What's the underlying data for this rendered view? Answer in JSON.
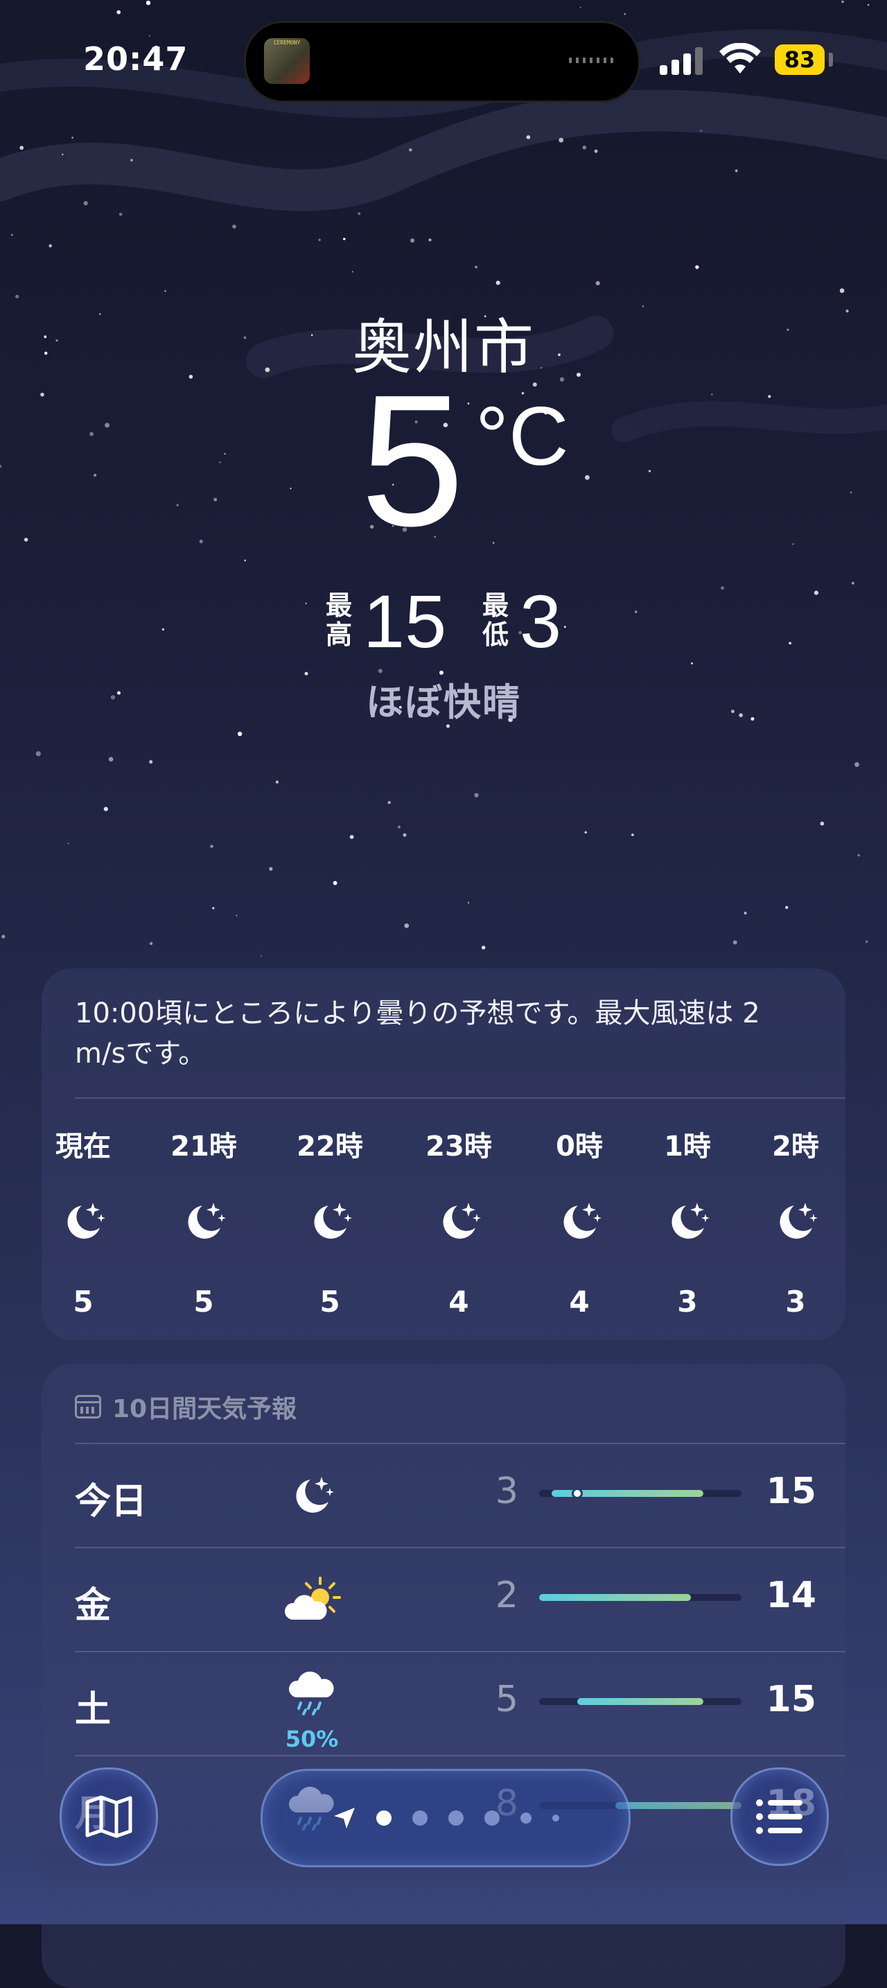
{
  "status_bar": {
    "time": "20:47",
    "battery": "83",
    "now_playing_art_text": "CEREMONY"
  },
  "current": {
    "city": "奥州市",
    "temperature": "5",
    "unit": "°C",
    "high_label": "最高",
    "high": "15",
    "low_label": "最低",
    "low": "3",
    "condition": "ほぼ快晴"
  },
  "hourly_card": {
    "summary": "10:00頃にところにより曇りの予想です。最大風速は 2 m/sです。",
    "hours": [
      {
        "label": "現在",
        "icon": "moon-stars-icon",
        "temp": "5"
      },
      {
        "label": "21時",
        "icon": "moon-stars-icon",
        "temp": "5"
      },
      {
        "label": "22時",
        "icon": "moon-stars-icon",
        "temp": "5"
      },
      {
        "label": "23時",
        "icon": "moon-stars-icon",
        "temp": "4"
      },
      {
        "label": "0時",
        "icon": "moon-stars-icon",
        "temp": "4"
      },
      {
        "label": "1時",
        "icon": "moon-stars-icon",
        "temp": "3"
      },
      {
        "label": "2時",
        "icon": "moon-stars-icon",
        "temp": "3"
      }
    ]
  },
  "daily_card": {
    "title": "10日間天気予報",
    "range_min": 2,
    "range_max": 18,
    "days": [
      {
        "name": "今日",
        "icon": "moon-stars-icon",
        "pop": "",
        "low": "3",
        "high": "15",
        "low_value": 3,
        "high_value": 15,
        "current_value": 5
      },
      {
        "name": "金",
        "icon": "partly-cloudy-sun-icon",
        "pop": "",
        "low": "2",
        "high": "14",
        "low_value": 2,
        "high_value": 14
      },
      {
        "name": "土",
        "icon": "cloud-rain-icon",
        "pop": "50%",
        "low": "5",
        "high": "15",
        "low_value": 5,
        "high_value": 15
      },
      {
        "name": "月",
        "icon": "cloud-rain-icon",
        "pop": "",
        "low": "8",
        "high": "18",
        "low_value": 8,
        "high_value": 18
      }
    ]
  },
  "toolbar": {
    "map_icon": "map-icon",
    "list_icon": "list-icon",
    "location_icon": "location-arrow-icon",
    "page_count": 7,
    "active_page": 1
  },
  "colors": {
    "bar_cool": "#5ecbe0",
    "bar_warm": "#9bd39a",
    "pop_blue": "#5fc8f0",
    "battery": "#ffd60a"
  }
}
